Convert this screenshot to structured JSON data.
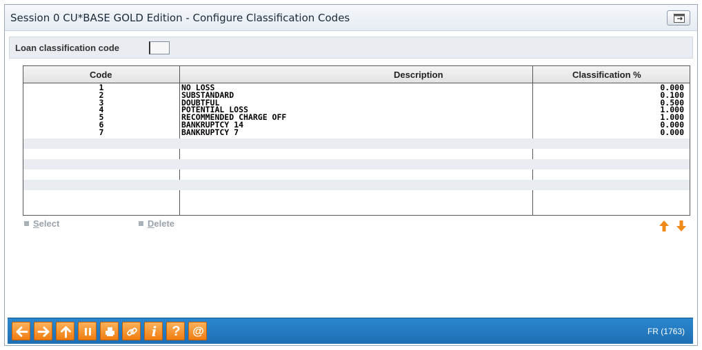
{
  "window": {
    "title": "Session 0 CU*BASE GOLD Edition - Configure Classification Codes"
  },
  "filter": {
    "label": "Loan classification code",
    "value": ""
  },
  "table": {
    "columns": [
      "Code",
      "Description",
      "Classification %"
    ],
    "rows": [
      {
        "code": "1",
        "description": "NO LOSS",
        "pct": "0.000"
      },
      {
        "code": "2",
        "description": "SUBSTANDARD",
        "pct": "0.100"
      },
      {
        "code": "3",
        "description": "DOUBTFUL",
        "pct": "0.500"
      },
      {
        "code": "4",
        "description": "POTENTIAL LOSS",
        "pct": "1.000"
      },
      {
        "code": "5",
        "description": "RECOMMENDED CHARGE OFF",
        "pct": "1.000"
      },
      {
        "code": "6",
        "description": "BANKRUPTCY 14",
        "pct": "0.000"
      },
      {
        "code": "7",
        "description": "BANKRUPTCY 7",
        "pct": "0.000"
      }
    ]
  },
  "actions": {
    "select_hotkey": "S",
    "select_rest": "elect",
    "delete_hotkey": "D",
    "delete_rest": "elete"
  },
  "toolbar": {
    "buttons": [
      "back-icon",
      "forward-icon",
      "up-icon",
      "pause-icon",
      "print-icon",
      "link-icon",
      "info-icon",
      "help-icon",
      "at-icon"
    ],
    "info_glyph": "i",
    "help_glyph": "?",
    "at_glyph": "@"
  },
  "status": {
    "screen_id": "FR (1763)"
  },
  "colors": {
    "accent_bar": "#1e6fb3",
    "button_orange": "#f07d12",
    "arrow_orange": "#f08a1a"
  }
}
